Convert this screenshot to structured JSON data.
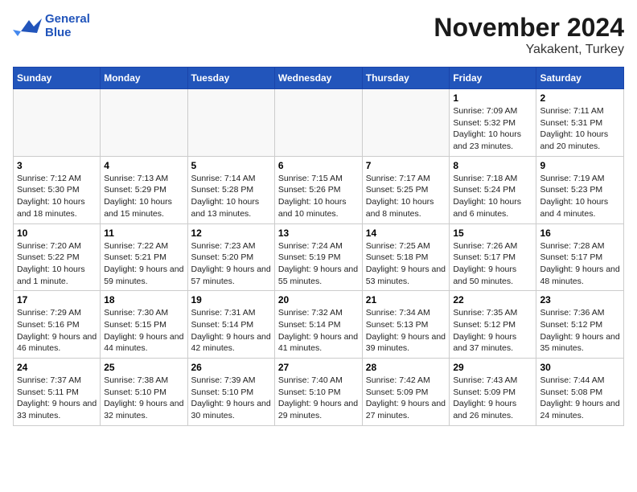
{
  "header": {
    "logo_line1": "General",
    "logo_line2": "Blue",
    "month": "November 2024",
    "location": "Yakakent, Turkey"
  },
  "weekdays": [
    "Sunday",
    "Monday",
    "Tuesday",
    "Wednesday",
    "Thursday",
    "Friday",
    "Saturday"
  ],
  "weeks": [
    [
      {
        "day": "",
        "info": ""
      },
      {
        "day": "",
        "info": ""
      },
      {
        "day": "",
        "info": ""
      },
      {
        "day": "",
        "info": ""
      },
      {
        "day": "",
        "info": ""
      },
      {
        "day": "1",
        "info": "Sunrise: 7:09 AM\nSunset: 5:32 PM\nDaylight: 10 hours and 23 minutes."
      },
      {
        "day": "2",
        "info": "Sunrise: 7:11 AM\nSunset: 5:31 PM\nDaylight: 10 hours and 20 minutes."
      }
    ],
    [
      {
        "day": "3",
        "info": "Sunrise: 7:12 AM\nSunset: 5:30 PM\nDaylight: 10 hours and 18 minutes."
      },
      {
        "day": "4",
        "info": "Sunrise: 7:13 AM\nSunset: 5:29 PM\nDaylight: 10 hours and 15 minutes."
      },
      {
        "day": "5",
        "info": "Sunrise: 7:14 AM\nSunset: 5:28 PM\nDaylight: 10 hours and 13 minutes."
      },
      {
        "day": "6",
        "info": "Sunrise: 7:15 AM\nSunset: 5:26 PM\nDaylight: 10 hours and 10 minutes."
      },
      {
        "day": "7",
        "info": "Sunrise: 7:17 AM\nSunset: 5:25 PM\nDaylight: 10 hours and 8 minutes."
      },
      {
        "day": "8",
        "info": "Sunrise: 7:18 AM\nSunset: 5:24 PM\nDaylight: 10 hours and 6 minutes."
      },
      {
        "day": "9",
        "info": "Sunrise: 7:19 AM\nSunset: 5:23 PM\nDaylight: 10 hours and 4 minutes."
      }
    ],
    [
      {
        "day": "10",
        "info": "Sunrise: 7:20 AM\nSunset: 5:22 PM\nDaylight: 10 hours and 1 minute."
      },
      {
        "day": "11",
        "info": "Sunrise: 7:22 AM\nSunset: 5:21 PM\nDaylight: 9 hours and 59 minutes."
      },
      {
        "day": "12",
        "info": "Sunrise: 7:23 AM\nSunset: 5:20 PM\nDaylight: 9 hours and 57 minutes."
      },
      {
        "day": "13",
        "info": "Sunrise: 7:24 AM\nSunset: 5:19 PM\nDaylight: 9 hours and 55 minutes."
      },
      {
        "day": "14",
        "info": "Sunrise: 7:25 AM\nSunset: 5:18 PM\nDaylight: 9 hours and 53 minutes."
      },
      {
        "day": "15",
        "info": "Sunrise: 7:26 AM\nSunset: 5:17 PM\nDaylight: 9 hours and 50 minutes."
      },
      {
        "day": "16",
        "info": "Sunrise: 7:28 AM\nSunset: 5:17 PM\nDaylight: 9 hours and 48 minutes."
      }
    ],
    [
      {
        "day": "17",
        "info": "Sunrise: 7:29 AM\nSunset: 5:16 PM\nDaylight: 9 hours and 46 minutes."
      },
      {
        "day": "18",
        "info": "Sunrise: 7:30 AM\nSunset: 5:15 PM\nDaylight: 9 hours and 44 minutes."
      },
      {
        "day": "19",
        "info": "Sunrise: 7:31 AM\nSunset: 5:14 PM\nDaylight: 9 hours and 42 minutes."
      },
      {
        "day": "20",
        "info": "Sunrise: 7:32 AM\nSunset: 5:14 PM\nDaylight: 9 hours and 41 minutes."
      },
      {
        "day": "21",
        "info": "Sunrise: 7:34 AM\nSunset: 5:13 PM\nDaylight: 9 hours and 39 minutes."
      },
      {
        "day": "22",
        "info": "Sunrise: 7:35 AM\nSunset: 5:12 PM\nDaylight: 9 hours and 37 minutes."
      },
      {
        "day": "23",
        "info": "Sunrise: 7:36 AM\nSunset: 5:12 PM\nDaylight: 9 hours and 35 minutes."
      }
    ],
    [
      {
        "day": "24",
        "info": "Sunrise: 7:37 AM\nSunset: 5:11 PM\nDaylight: 9 hours and 33 minutes."
      },
      {
        "day": "25",
        "info": "Sunrise: 7:38 AM\nSunset: 5:10 PM\nDaylight: 9 hours and 32 minutes."
      },
      {
        "day": "26",
        "info": "Sunrise: 7:39 AM\nSunset: 5:10 PM\nDaylight: 9 hours and 30 minutes."
      },
      {
        "day": "27",
        "info": "Sunrise: 7:40 AM\nSunset: 5:10 PM\nDaylight: 9 hours and 29 minutes."
      },
      {
        "day": "28",
        "info": "Sunrise: 7:42 AM\nSunset: 5:09 PM\nDaylight: 9 hours and 27 minutes."
      },
      {
        "day": "29",
        "info": "Sunrise: 7:43 AM\nSunset: 5:09 PM\nDaylight: 9 hours and 26 minutes."
      },
      {
        "day": "30",
        "info": "Sunrise: 7:44 AM\nSunset: 5:08 PM\nDaylight: 9 hours and 24 minutes."
      }
    ]
  ]
}
